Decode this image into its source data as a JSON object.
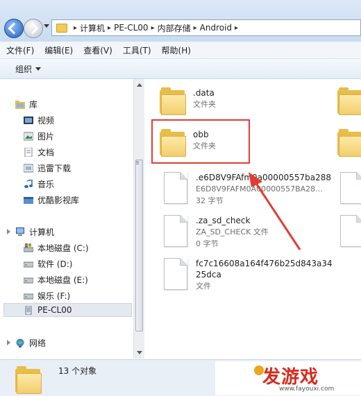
{
  "address_bar": {
    "crumbs": [
      "计算机",
      "PE-CL00",
      "内部存储",
      "Android"
    ]
  },
  "menu": [
    "文件(F)",
    "编辑(E)",
    "查看(V)",
    "工具(T)",
    "帮助(H)"
  ],
  "toolbar": {
    "organize": "组织"
  },
  "nav": {
    "library": "库",
    "library_items": [
      "视频",
      "图片",
      "文档",
      "迅雷下载",
      "音乐",
      "优酷影视库"
    ],
    "computer": "计算机",
    "drives": [
      "本地磁盘 (C:)",
      "软件 (D:)",
      "本地磁盘 (E:)",
      "娱乐 (F:)",
      "PE-CL00"
    ],
    "network": "网络"
  },
  "items": [
    {
      "name": ".data",
      "sub": [
        "文件夹"
      ],
      "kind": "folder"
    },
    {
      "name": "obb",
      "sub": [
        "文件夹"
      ],
      "kind": "folder",
      "highlighted": true
    },
    {
      "name": ".e6D8V9FAfm0a00000557ba288",
      "sub": [
        "E6D8V9FAFM0A00000557BA28...",
        "32 字节"
      ],
      "kind": "file"
    },
    {
      "name": ".za_sd_check",
      "sub": [
        "ZA_SD_CHECK 文件",
        "0 字节"
      ],
      "kind": "file"
    },
    {
      "name": "fc7c16608a164f476b25d843a34",
      "name2": "25dca",
      "sub": [
        "文件"
      ],
      "kind": "file"
    }
  ],
  "details": {
    "count": "13 个对象"
  },
  "watermark": {
    "name": "发游戏",
    "url": "www.fayouxi.com"
  },
  "colors": {
    "highlight": "#e23b32",
    "arrow": "#e23b32",
    "folder": "#e8bd48"
  }
}
